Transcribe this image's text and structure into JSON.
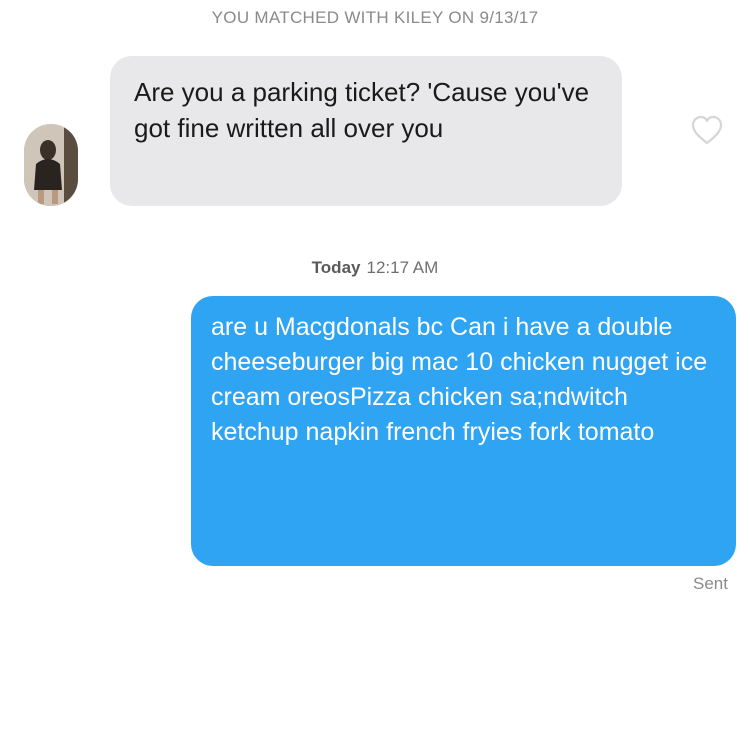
{
  "header": {
    "match_text": "YOU MATCHED WITH KILEY ON 9/13/17"
  },
  "received_message": {
    "text": "Are you a parking ticket? 'Cause you've got fine written all over you",
    "avatar_icon": "profile-photo",
    "like_icon": "heart-outline-icon",
    "bubble_color": "#e8e8ea"
  },
  "divider": {
    "day": "Today",
    "time": "12:17 AM"
  },
  "sent_message": {
    "text": "are u Macgdonals bc Can i have a double cheeseburger big mac 10 chicken nugget ice cream oreosPizza chicken sa;ndwitch ketchup napkin french fryies fork tomato",
    "status": "Sent",
    "bubble_color": "#2fa4f2"
  }
}
